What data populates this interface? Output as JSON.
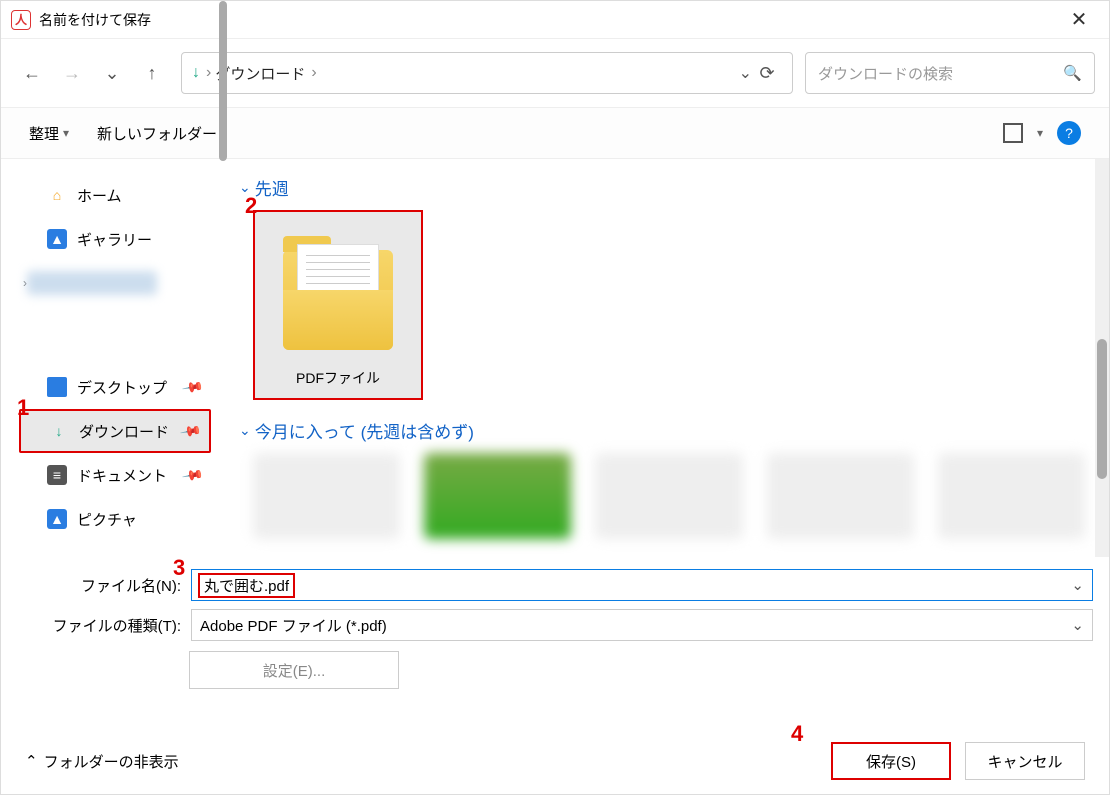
{
  "title": "名前を付けて保存",
  "breadcrumb": "ダウンロード",
  "search_placeholder": "ダウンロードの検索",
  "toolbar": {
    "organize": "整理",
    "new_folder": "新しいフォルダー"
  },
  "sidebar": {
    "home": "ホーム",
    "gallery": "ギャラリー",
    "desktop": "デスクトップ",
    "downloads": "ダウンロード",
    "documents": "ドキュメント",
    "pictures": "ピクチャ"
  },
  "groups": {
    "last_week": "先週",
    "this_month": "今月に入って (先週は含めず)"
  },
  "folder_item": "PDFファイル",
  "form": {
    "filename_label": "ファイル名(N):",
    "filename_value": "丸で囲む.pdf",
    "filetype_label": "ファイルの種類(T):",
    "filetype_value": "Adobe PDF ファイル (*.pdf)",
    "settings": "設定(E)..."
  },
  "footer": {
    "hide_folders": "フォルダーの非表示",
    "save": "保存(S)",
    "cancel": "キャンセル"
  },
  "annotations": {
    "a1": "1",
    "a2": "2",
    "a3": "3",
    "a4": "4"
  }
}
